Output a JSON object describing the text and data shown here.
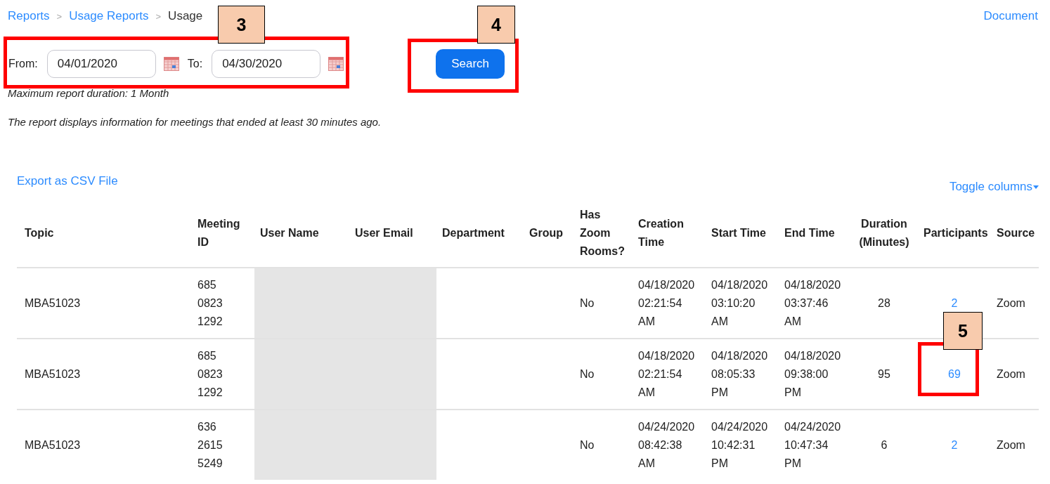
{
  "breadcrumb": [
    {
      "kind": "link",
      "text": "Reports"
    },
    {
      "kind": "separator",
      "text": ">"
    },
    {
      "kind": "link",
      "text": "Usage Reports"
    },
    {
      "kind": "separator",
      "text": ">"
    },
    {
      "kind": "current",
      "text": "Usage"
    }
  ],
  "document_link": "Document",
  "filter": {
    "from_label": "From:",
    "from_value": "04/01/2020",
    "to_label": "To:",
    "to_value": "04/30/2020",
    "search_button": "Search"
  },
  "notes": [
    "Maximum report duration: 1 Month",
    "The report displays information for meetings that ended at least 30 minutes ago."
  ],
  "export_link": "Export as CSV File",
  "toggle_columns": "Toggle columns",
  "table": {
    "columns": [
      "Topic",
      "Meeting ID",
      "User Name",
      "User Email",
      "Department",
      "Group",
      "Has Zoom Rooms?",
      "Creation Time",
      "Start Time",
      "End Time",
      "Duration (Minutes)",
      "Participants",
      "Source"
    ],
    "rows": [
      {
        "topic": "MBA51023",
        "meeting_id": "685 0823 1292",
        "user_name_redacted": true,
        "user_email_redacted": true,
        "department": "",
        "group": "",
        "has_zoom_rooms": "No",
        "creation_time": "04/18/2020 02:21:54 AM",
        "start_time": "04/18/2020 03:10:20 AM",
        "end_time": "04/18/2020 03:37:46 AM",
        "duration": "28",
        "participants": "2",
        "source": "Zoom"
      },
      {
        "topic": "MBA51023",
        "meeting_id": "685 0823 1292",
        "user_name_redacted": true,
        "user_email_redacted": true,
        "department": "",
        "group": "",
        "has_zoom_rooms": "No",
        "creation_time": "04/18/2020 02:21:54 AM",
        "start_time": "04/18/2020 08:05:33 PM",
        "end_time": "04/18/2020 09:38:00 PM",
        "duration": "95",
        "participants": "69",
        "source": "Zoom"
      },
      {
        "topic": "MBA51023",
        "meeting_id": "636 2615 5249",
        "user_name_redacted": true,
        "user_email_redacted": true,
        "department": "",
        "group": "",
        "has_zoom_rooms": "No",
        "creation_time": "04/24/2020 08:42:38 AM",
        "start_time": "04/24/2020 10:42:31 PM",
        "end_time": "04/24/2020 10:47:34 PM",
        "duration": "6",
        "participants": "2",
        "source": "Zoom"
      }
    ]
  },
  "annotations": [
    {
      "label": "3"
    },
    {
      "label": "4"
    },
    {
      "label": "5"
    }
  ]
}
